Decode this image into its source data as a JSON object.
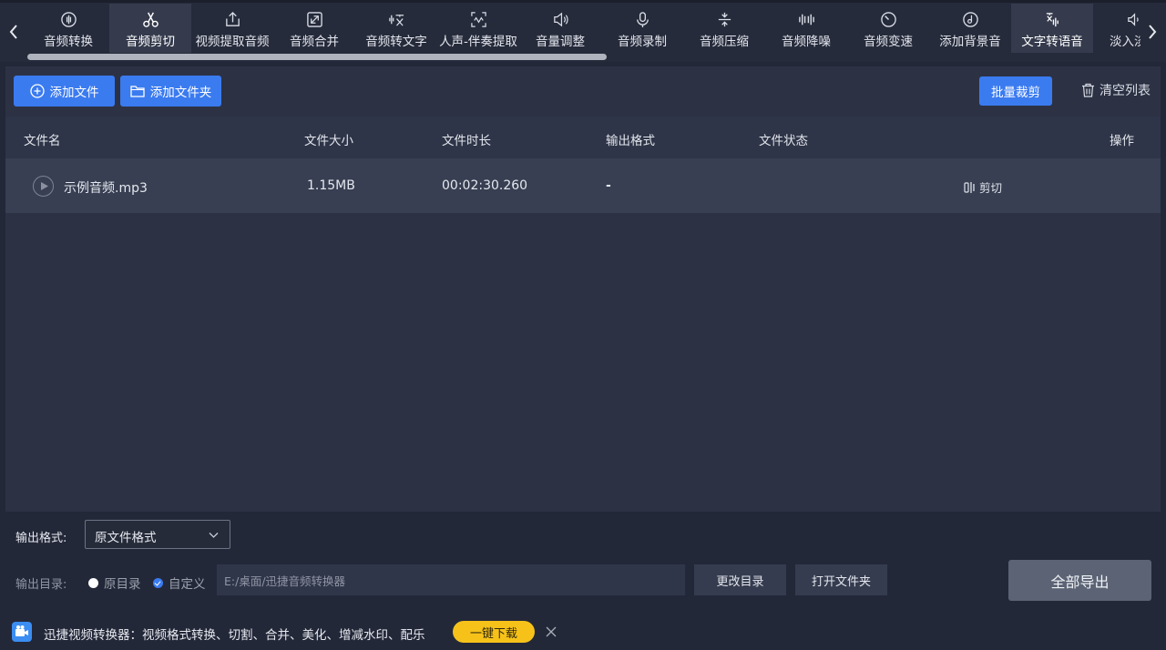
{
  "toolbar": {
    "tools": [
      {
        "label": "音频转换",
        "icon": "audio-wave-icon"
      },
      {
        "label": "音频剪切",
        "icon": "scissors-icon",
        "active": true
      },
      {
        "label": "视频提取音频",
        "icon": "upload-icon"
      },
      {
        "label": "音频合并",
        "icon": "merge-icon"
      },
      {
        "label": "音频转文字",
        "icon": "audio-to-text-icon"
      },
      {
        "label": "人声-伴奏提取",
        "icon": "vocal-extract-icon"
      },
      {
        "label": "音量调整",
        "icon": "volume-icon"
      },
      {
        "label": "音频录制",
        "icon": "microphone-icon"
      },
      {
        "label": "音频压缩",
        "icon": "compress-icon"
      },
      {
        "label": "音频降噪",
        "icon": "denoise-icon"
      },
      {
        "label": "音频变速",
        "icon": "speed-icon"
      },
      {
        "label": "添加背景音",
        "icon": "music-disc-icon"
      },
      {
        "label": "文字转语音",
        "icon": "text-to-speech-icon",
        "hovered": true
      },
      {
        "label": "淡入淡出",
        "icon": "fade-icon"
      }
    ]
  },
  "actions": {
    "add_file": "添加文件",
    "add_folder": "添加文件夹",
    "batch_cut": "批量裁剪",
    "clear_list": "清空列表"
  },
  "table": {
    "headers": {
      "name": "文件名",
      "size": "文件大小",
      "duration": "文件时长",
      "format": "输出格式",
      "status": "文件状态",
      "action": "操作"
    },
    "rows": [
      {
        "name": "示例音频.mp3",
        "size": "1.15MB",
        "duration": "00:02:30.260",
        "format": "-",
        "status": "",
        "action": "剪切"
      }
    ]
  },
  "output": {
    "format_label": "输出格式:",
    "format_value": "原文件格式",
    "dir_label": "输出目录:",
    "radio_original": "原目录",
    "radio_custom": "自定义",
    "path_value": "E:/桌面/迅捷音频转换器",
    "change_dir": "更改目录",
    "open_folder": "打开文件夹",
    "export_all": "全部导出"
  },
  "promo": {
    "text": "迅捷视频转换器：视频格式转换、切割、合并、美化、增减水印、配乐",
    "download": "一键下载"
  },
  "colors": {
    "accent": "#3b7bf0",
    "download_button": "#f6c21a",
    "background": "#232839",
    "panel": "#2c3244"
  }
}
